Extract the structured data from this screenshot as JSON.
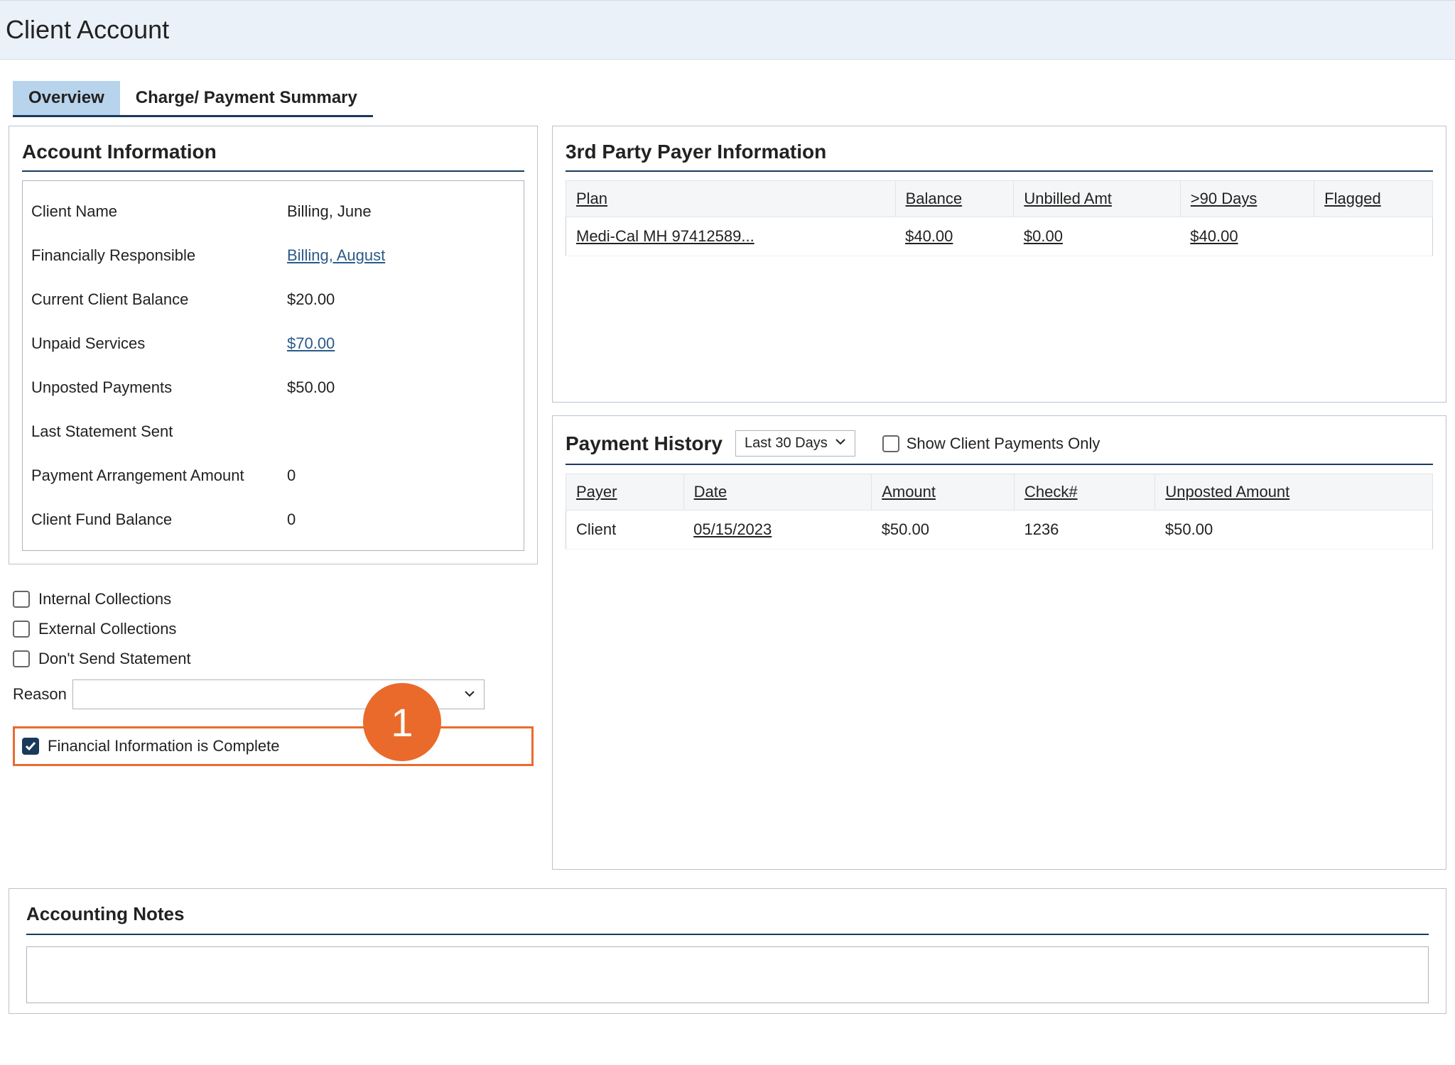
{
  "page": {
    "title": "Client Account"
  },
  "tabs": [
    {
      "label": "Overview",
      "active": true
    },
    {
      "label": "Charge/ Payment Summary",
      "active": false
    }
  ],
  "account_info": {
    "heading": "Account Information",
    "rows": {
      "client_name": {
        "label": "Client Name",
        "value": "Billing, June"
      },
      "fin_responsible": {
        "label": "Financially Responsible",
        "value": "Billing, August",
        "link": true
      },
      "current_balance": {
        "label": "Current Client Balance",
        "value": "$20.00"
      },
      "unpaid_services": {
        "label": "Unpaid Services",
        "value": "$70.00",
        "link": true
      },
      "unposted_payments": {
        "label": "Unposted Payments",
        "value": "$50.00"
      },
      "last_statement": {
        "label": "Last Statement Sent",
        "value": ""
      },
      "payment_arrangement": {
        "label": "Payment Arrangement Amount",
        "value": "0"
      },
      "client_fund_balance": {
        "label": "Client Fund Balance",
        "value": "0"
      }
    }
  },
  "checkboxes": {
    "internal_collections": "Internal Collections",
    "external_collections": "External Collections",
    "dont_send_statement": "Don't Send Statement",
    "reason_label": "Reason",
    "financial_complete": "Financial Information is Complete"
  },
  "callout": {
    "number": "1"
  },
  "payer_info": {
    "heading": "3rd Party Payer Information",
    "columns": {
      "plan": "Plan",
      "balance": "Balance",
      "unbilled": "Unbilled Amt",
      "days90": ">90 Days",
      "flagged": "Flagged"
    },
    "rows": [
      {
        "plan": "Medi-Cal MH 97412589...",
        "balance": "$40.00",
        "unbilled": "$0.00",
        "days90": "$40.00",
        "flagged": ""
      }
    ]
  },
  "payment_history": {
    "heading": "Payment History",
    "range": "Last 30 Days",
    "show_client_only": "Show Client Payments Only",
    "columns": {
      "payer": "Payer",
      "date": "Date",
      "amount": "Amount",
      "check": "Check#",
      "unposted": "Unposted Amount"
    },
    "rows": [
      {
        "payer": "Client",
        "date": "05/15/2023",
        "amount": "$50.00",
        "check": "1236",
        "unposted": "$50.00"
      }
    ]
  },
  "accounting_notes": {
    "heading": "Accounting Notes"
  }
}
